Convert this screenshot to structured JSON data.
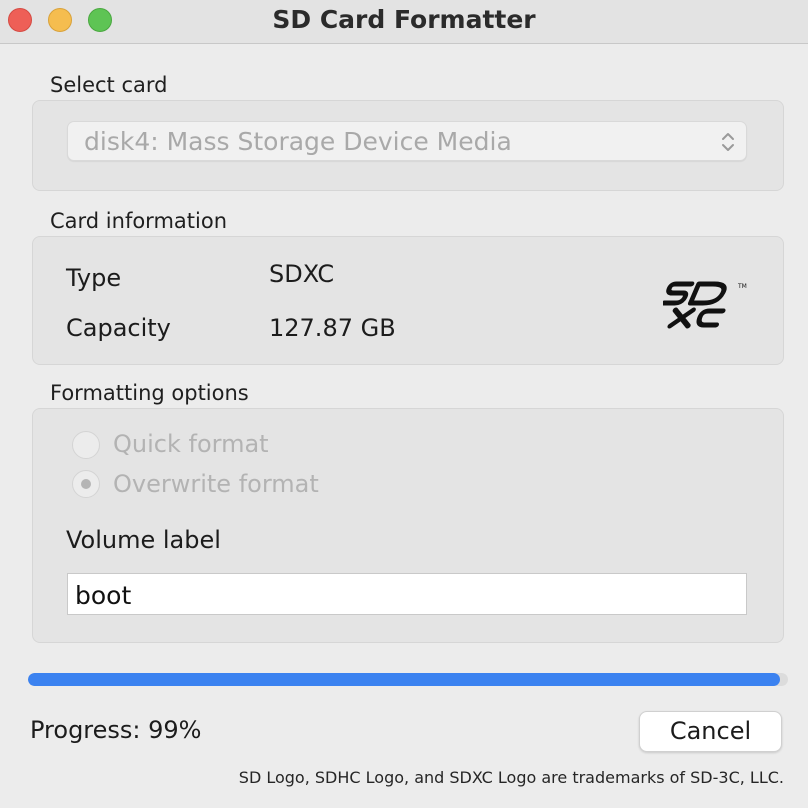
{
  "window": {
    "title": "SD Card Formatter"
  },
  "select_card": {
    "label": "Select card",
    "selected_value": "disk4: Mass Storage Device Media"
  },
  "card_info": {
    "label": "Card information",
    "type_key": "Type",
    "type_value": "SDXC",
    "capacity_key": "Capacity",
    "capacity_value": "127.87 GB",
    "logo_icon": "sdxc-logo"
  },
  "formatting": {
    "label": "Formatting options",
    "quick_format_label": "Quick format",
    "overwrite_format_label": "Overwrite format",
    "selected_option": "Overwrite format",
    "volume_label_caption": "Volume label",
    "volume_label_value": "boot"
  },
  "progress": {
    "text": "Progress: 99%",
    "fraction": 0.99
  },
  "buttons": {
    "cancel_label": "Cancel"
  },
  "footer": {
    "trademark_text": "SD Logo, SDHC Logo, and SDXC Logo are trademarks of SD-3C, LLC."
  },
  "colors": {
    "progress_fill": "#3b82f0",
    "close_button": "#ee5f57",
    "minimize_button": "#f5bd4f",
    "maximize_button": "#5ec454"
  }
}
